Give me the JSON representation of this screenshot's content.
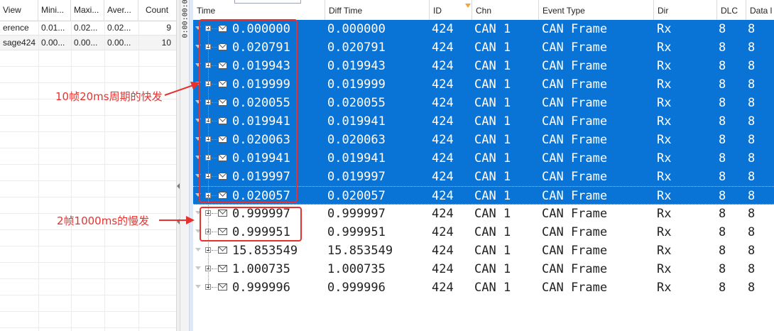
{
  "stats_pane": {
    "columns": [
      "View",
      "Mini...",
      "Maxi...",
      "Aver...",
      "Count"
    ],
    "rows": [
      {
        "name": "erence",
        "min": "0.01...",
        "max": "0.02...",
        "avg": "0.02...",
        "count": "9"
      },
      {
        "name": "sage424",
        "min": "0.00...",
        "max": "0.00...",
        "avg": "0.00...",
        "count": "10"
      }
    ]
  },
  "ruler": {
    "label": "0:00:00:00"
  },
  "trace": {
    "columns": [
      "Time",
      "Diff Time",
      "ID",
      "Chn",
      "Event Type",
      "Dir",
      "DLC",
      "Data l"
    ],
    "rows": [
      {
        "time": "0.000000",
        "diff": "0.000000",
        "id": "424",
        "chn": "CAN 1",
        "event": "CAN Frame",
        "dir": "Rx",
        "dlc": "8",
        "data": "8",
        "selected": true
      },
      {
        "time": "0.020791",
        "diff": "0.020791",
        "id": "424",
        "chn": "CAN 1",
        "event": "CAN Frame",
        "dir": "Rx",
        "dlc": "8",
        "data": "8",
        "selected": true
      },
      {
        "time": "0.019943",
        "diff": "0.019943",
        "id": "424",
        "chn": "CAN 1",
        "event": "CAN Frame",
        "dir": "Rx",
        "dlc": "8",
        "data": "8",
        "selected": true
      },
      {
        "time": "0.019999",
        "diff": "0.019999",
        "id": "424",
        "chn": "CAN 1",
        "event": "CAN Frame",
        "dir": "Rx",
        "dlc": "8",
        "data": "8",
        "selected": true
      },
      {
        "time": "0.020055",
        "diff": "0.020055",
        "id": "424",
        "chn": "CAN 1",
        "event": "CAN Frame",
        "dir": "Rx",
        "dlc": "8",
        "data": "8",
        "selected": true
      },
      {
        "time": "0.019941",
        "diff": "0.019941",
        "id": "424",
        "chn": "CAN 1",
        "event": "CAN Frame",
        "dir": "Rx",
        "dlc": "8",
        "data": "8",
        "selected": true
      },
      {
        "time": "0.020063",
        "diff": "0.020063",
        "id": "424",
        "chn": "CAN 1",
        "event": "CAN Frame",
        "dir": "Rx",
        "dlc": "8",
        "data": "8",
        "selected": true
      },
      {
        "time": "0.019941",
        "diff": "0.019941",
        "id": "424",
        "chn": "CAN 1",
        "event": "CAN Frame",
        "dir": "Rx",
        "dlc": "8",
        "data": "8",
        "selected": true
      },
      {
        "time": "0.019997",
        "diff": "0.019997",
        "id": "424",
        "chn": "CAN 1",
        "event": "CAN Frame",
        "dir": "Rx",
        "dlc": "8",
        "data": "8",
        "selected": true
      },
      {
        "time": "0.020057",
        "diff": "0.020057",
        "id": "424",
        "chn": "CAN 1",
        "event": "CAN Frame",
        "dir": "Rx",
        "dlc": "8",
        "data": "8",
        "selected": true
      },
      {
        "time": "0.999997",
        "diff": "0.999997",
        "id": "424",
        "chn": "CAN 1",
        "event": "CAN Frame",
        "dir": "Rx",
        "dlc": "8",
        "data": "8",
        "selected": false
      },
      {
        "time": "0.999951",
        "diff": "0.999951",
        "id": "424",
        "chn": "CAN 1",
        "event": "CAN Frame",
        "dir": "Rx",
        "dlc": "8",
        "data": "8",
        "selected": false
      },
      {
        "time": "15.853549",
        "diff": "15.853549",
        "id": "424",
        "chn": "CAN 1",
        "event": "CAN Frame",
        "dir": "Rx",
        "dlc": "8",
        "data": "8",
        "selected": false
      },
      {
        "time": "1.000735",
        "diff": "1.000735",
        "id": "424",
        "chn": "CAN 1",
        "event": "CAN Frame",
        "dir": "Rx",
        "dlc": "8",
        "data": "8",
        "selected": false
      },
      {
        "time": "0.999996",
        "diff": "0.999996",
        "id": "424",
        "chn": "CAN 1",
        "event": "CAN Frame",
        "dir": "Rx",
        "dlc": "8",
        "data": "8",
        "selected": false
      }
    ]
  },
  "annotations": {
    "fast_label": "10帧20ms周期的快发",
    "slow_label": "2帧1000ms的慢发"
  },
  "colors": {
    "selection": "#0a74d6",
    "annotation": "#e8312d",
    "sort_indicator": "#f2a53a"
  },
  "icons": {
    "message": "envelope-icon",
    "expand": "tree-expand-icon",
    "sort": "sort-descending-icon"
  }
}
